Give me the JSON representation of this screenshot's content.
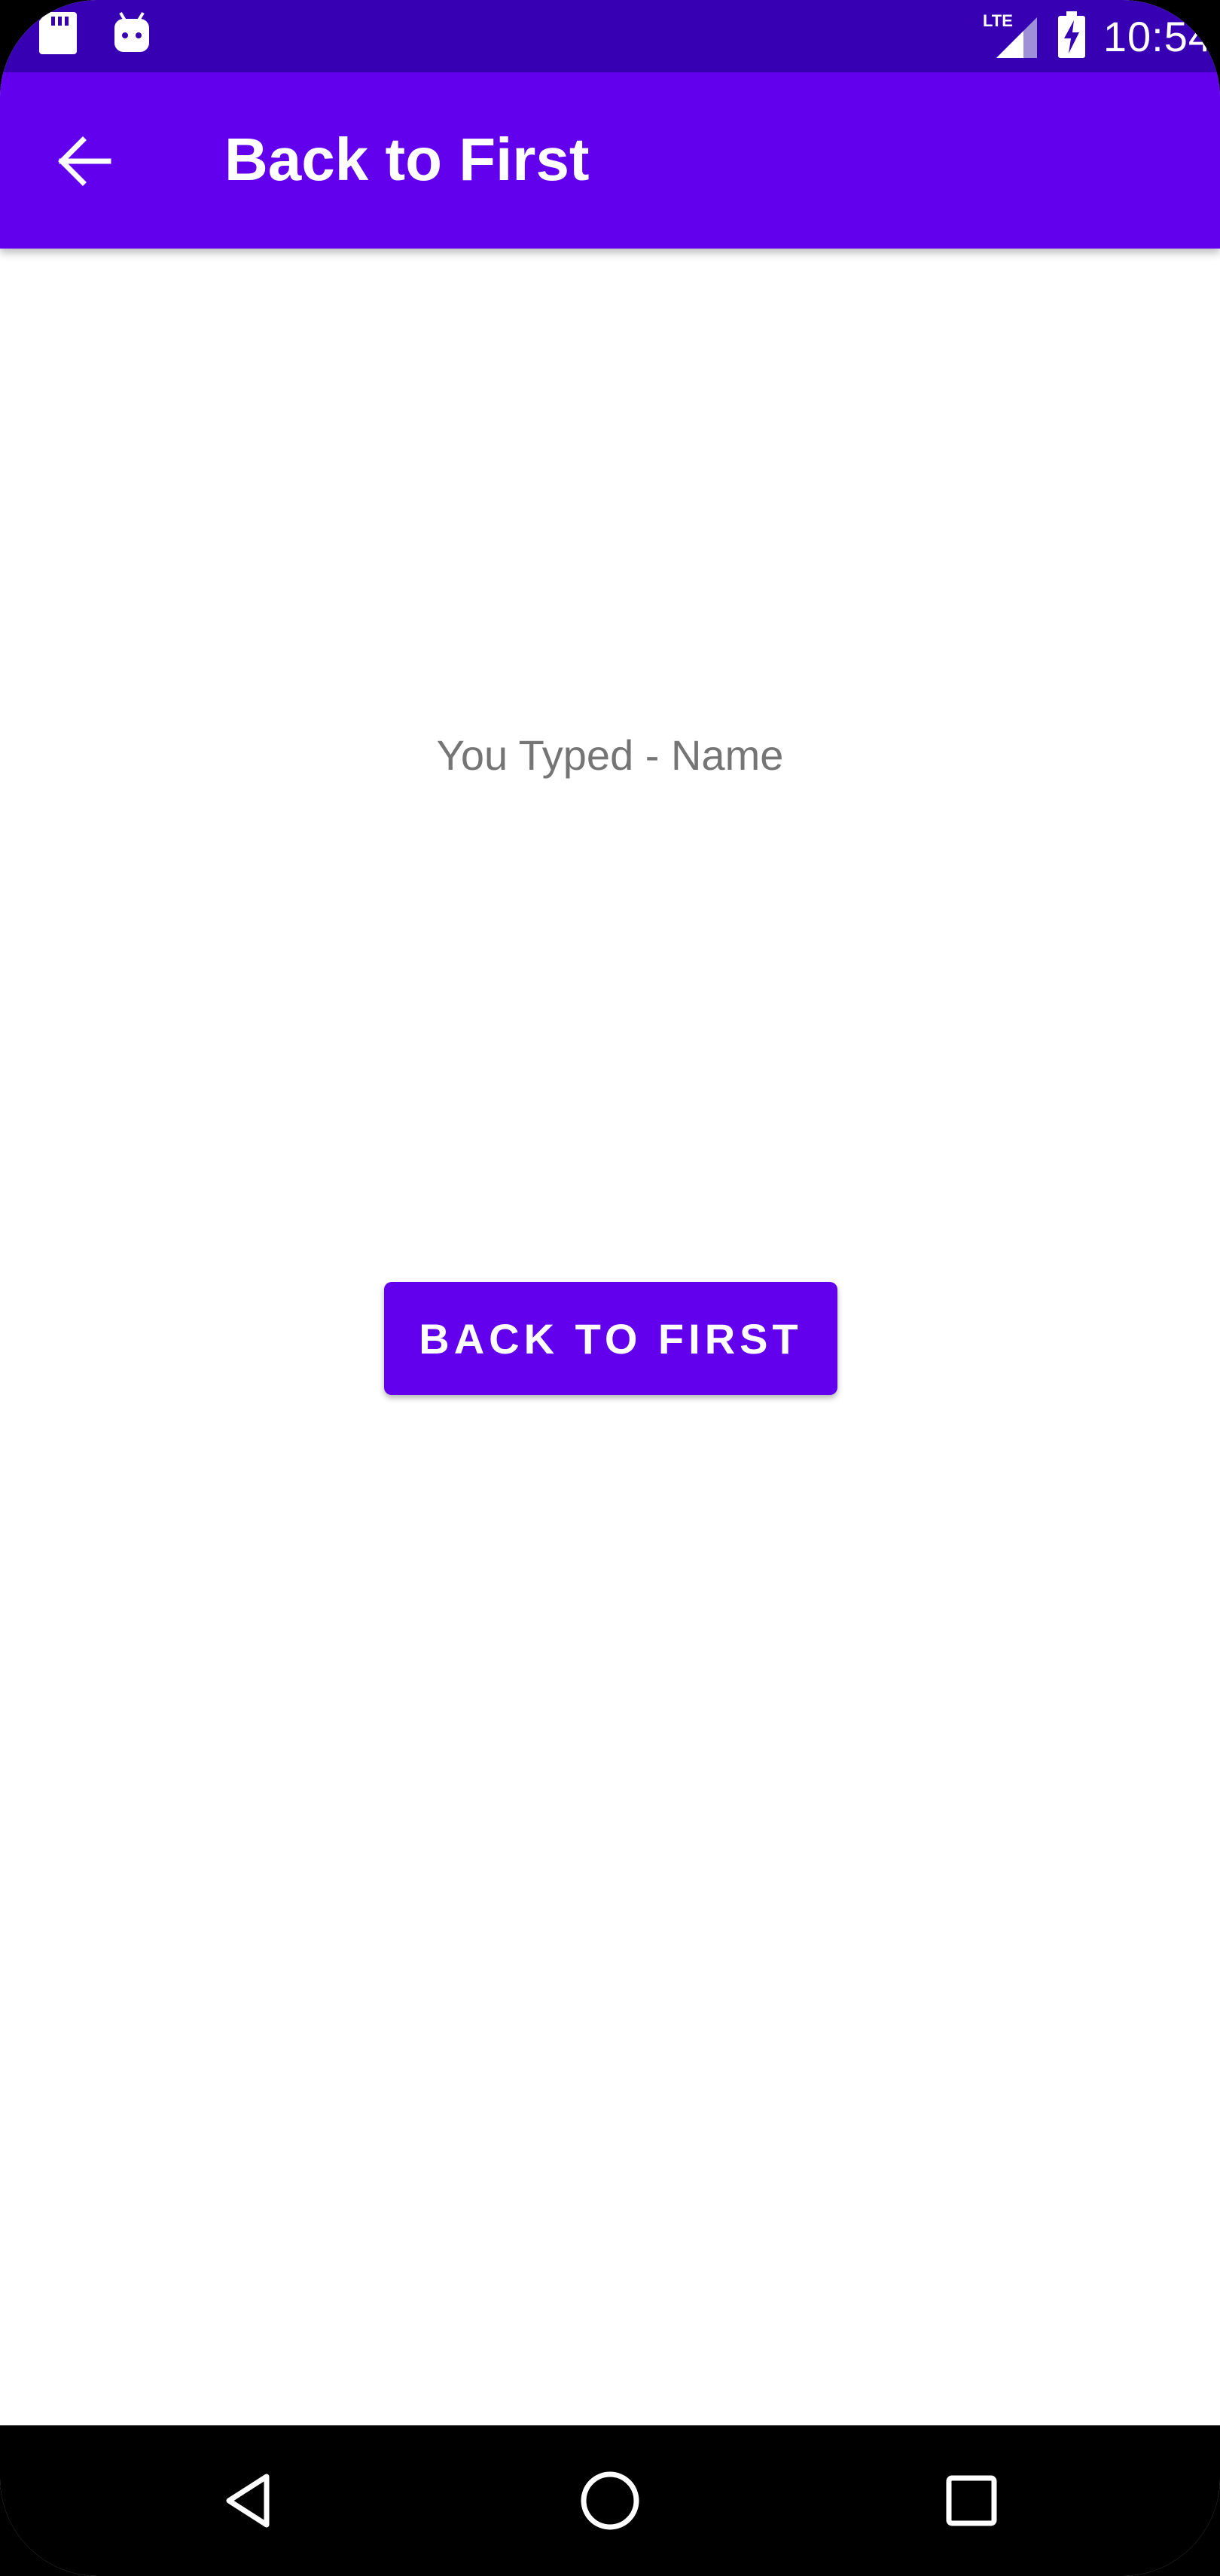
{
  "status_bar": {
    "time": "10:54",
    "network": "LTE",
    "icons": [
      "sd-card-icon",
      "android-icon",
      "lte-signal-icon",
      "battery-charging-icon"
    ]
  },
  "app_bar": {
    "title": "Back to First",
    "nav_icon": "back-arrow-icon"
  },
  "main": {
    "typed_text": "You Typed - Name",
    "button_label": "BACK TO FIRST"
  },
  "nav_bar": {
    "icons": [
      "nav-back-icon",
      "nav-home-icon",
      "nav-recents-icon"
    ]
  },
  "colors": {
    "status_bar": "#3700b3",
    "primary": "#6200ee",
    "text_secondary": "#757575",
    "background": "#ffffff"
  }
}
